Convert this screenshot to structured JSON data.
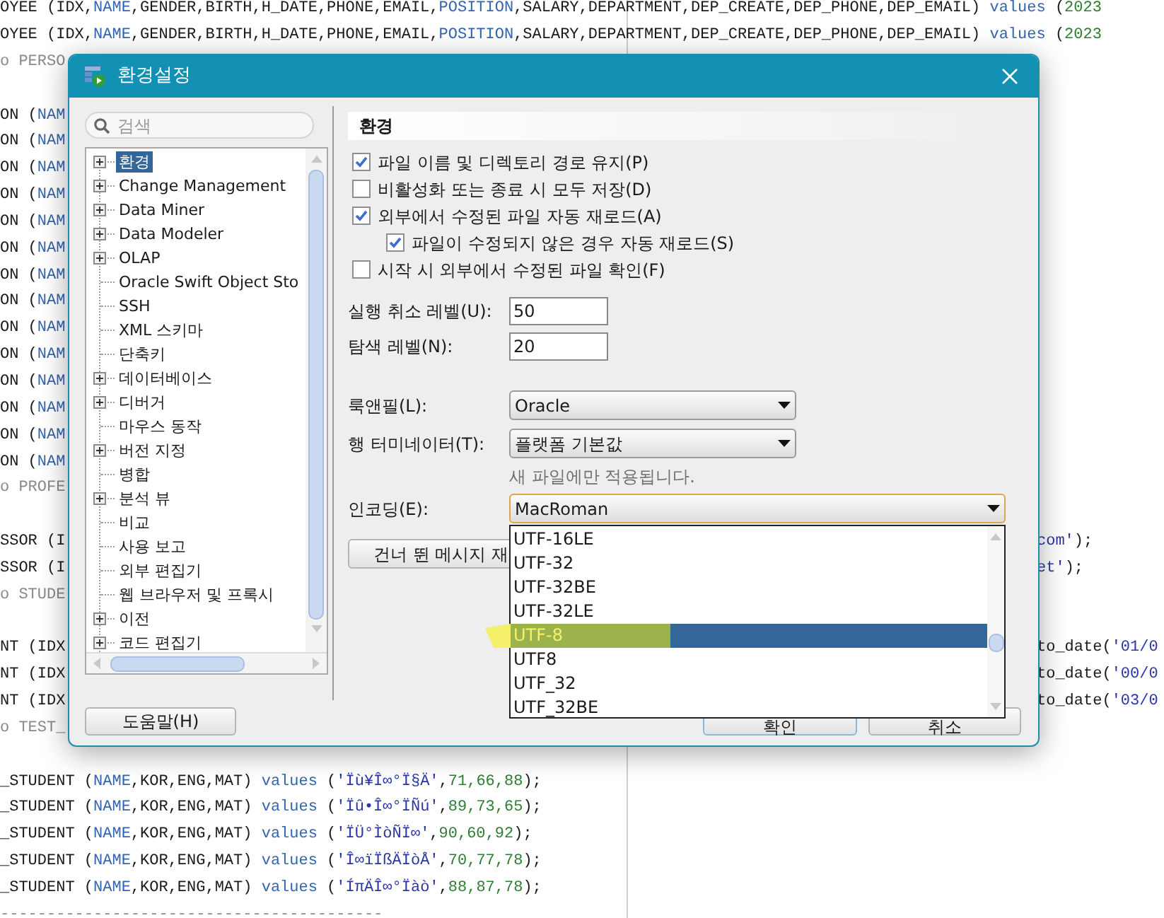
{
  "editor": {
    "lines": [
      {
        "left": [
          {
            "text": "OYEE (IDX,",
            "kind": "t"
          },
          {
            "text": "NAME",
            "kind": "k"
          },
          {
            "text": ",GENDER,BIRTH,H_DATE,PHONE,EMAIL,",
            "kind": "t"
          },
          {
            "text": "POSITION",
            "kind": "k"
          },
          {
            "text": ",SALARY,DEPARTMENT,DEP_CREATE,DEP_PHONE,DEP_EMAIL) ",
            "kind": "t"
          },
          {
            "text": "values",
            "kind": "k"
          },
          {
            "text": " (",
            "kind": "t"
          },
          {
            "text": "2023",
            "kind": "n"
          }
        ]
      },
      {
        "left": [
          {
            "text": "OYEE (IDX,",
            "kind": "t"
          },
          {
            "text": "NAME",
            "kind": "k"
          },
          {
            "text": ",GENDER,BIRTH,H_DATE,PHONE,EMAIL,",
            "kind": "t"
          },
          {
            "text": "POSITION",
            "kind": "k"
          },
          {
            "text": ",SALARY,DEPARTMENT,DEP_CREATE,DEP_PHONE,DEP_EMAIL) ",
            "kind": "t"
          },
          {
            "text": "values",
            "kind": "k"
          },
          {
            "text": " (",
            "kind": "t"
          },
          {
            "text": "2023",
            "kind": "n"
          }
        ]
      },
      {
        "left": [
          {
            "text": "o PERSO",
            "kind": "c"
          }
        ]
      },
      {
        "kind": "blank"
      },
      {
        "left": [
          {
            "text": "ON (",
            "kind": "t"
          },
          {
            "text": "NAM",
            "kind": "k"
          }
        ]
      },
      {
        "left": [
          {
            "text": "ON (",
            "kind": "t"
          },
          {
            "text": "NAM",
            "kind": "k"
          }
        ]
      },
      {
        "left": [
          {
            "text": "ON (",
            "kind": "t"
          },
          {
            "text": "NAM",
            "kind": "k"
          }
        ]
      },
      {
        "left": [
          {
            "text": "ON (",
            "kind": "t"
          },
          {
            "text": "NAM",
            "kind": "k"
          }
        ]
      },
      {
        "left": [
          {
            "text": "ON (",
            "kind": "t"
          },
          {
            "text": "NAM",
            "kind": "k"
          }
        ]
      },
      {
        "left": [
          {
            "text": "ON (",
            "kind": "t"
          },
          {
            "text": "NAM",
            "kind": "k"
          }
        ]
      },
      {
        "left": [
          {
            "text": "ON (",
            "kind": "t"
          },
          {
            "text": "NAM",
            "kind": "k"
          }
        ]
      },
      {
        "left": [
          {
            "text": "ON (",
            "kind": "t"
          },
          {
            "text": "NAM",
            "kind": "k"
          }
        ]
      },
      {
        "left": [
          {
            "text": "ON (",
            "kind": "t"
          },
          {
            "text": "NAM",
            "kind": "k"
          }
        ]
      },
      {
        "left": [
          {
            "text": "ON (",
            "kind": "t"
          },
          {
            "text": "NAM",
            "kind": "k"
          }
        ]
      },
      {
        "left": [
          {
            "text": "ON (",
            "kind": "t"
          },
          {
            "text": "NAM",
            "kind": "k"
          }
        ]
      },
      {
        "left": [
          {
            "text": "ON (",
            "kind": "t"
          },
          {
            "text": "NAM",
            "kind": "k"
          }
        ]
      },
      {
        "left": [
          {
            "text": "ON (",
            "kind": "t"
          },
          {
            "text": "NAM",
            "kind": "k"
          }
        ]
      },
      {
        "left": [
          {
            "text": "ON (",
            "kind": "t"
          },
          {
            "text": "NAM",
            "kind": "k"
          }
        ]
      },
      {
        "left": [
          {
            "text": "o PROFE",
            "kind": "c"
          }
        ]
      },
      {
        "kind": "blank"
      },
      {
        "left": [
          {
            "text": "SSOR (I",
            "kind": "t"
          }
        ],
        "right": [
          {
            "text": "com'",
            "kind": "s"
          },
          {
            "text": ");",
            "kind": "t"
          }
        ]
      },
      {
        "left": [
          {
            "text": "SSOR (I",
            "kind": "t"
          }
        ],
        "right": [
          {
            "text": "et'",
            "kind": "s"
          },
          {
            "text": ");",
            "kind": "t"
          }
        ]
      },
      {
        "left": [
          {
            "text": "o STUDE",
            "kind": "c"
          }
        ]
      },
      {
        "kind": "blank"
      },
      {
        "left": [
          {
            "text": "NT (IDX",
            "kind": "t"
          }
        ],
        "right": [
          {
            "text": "to_date(",
            "kind": "t"
          },
          {
            "text": "'01/0",
            "kind": "s"
          }
        ]
      },
      {
        "left": [
          {
            "text": "NT (IDX",
            "kind": "t"
          }
        ],
        "right": [
          {
            "text": "to_date(",
            "kind": "t"
          },
          {
            "text": "'00/0",
            "kind": "s"
          }
        ]
      },
      {
        "left": [
          {
            "text": "NT (IDX",
            "kind": "t"
          }
        ],
        "right": [
          {
            "text": "to_date(",
            "kind": "t"
          },
          {
            "text": "'03/0",
            "kind": "s"
          }
        ]
      },
      {
        "left": [
          {
            "text": "o TEST_",
            "kind": "c"
          }
        ]
      },
      {
        "kind": "blank"
      },
      {
        "left": [
          {
            "text": "_STUDENT (",
            "kind": "t"
          },
          {
            "text": "NAME",
            "kind": "k"
          },
          {
            "text": ",KOR,ENG,MAT) ",
            "kind": "t"
          },
          {
            "text": "values",
            "kind": "k"
          },
          {
            "text": " (",
            "kind": "t"
          },
          {
            "text": "'Ïù¥Î∞°Ï§Ä'",
            "kind": "s"
          },
          {
            "text": ",",
            "kind": "t"
          },
          {
            "text": "71,66,88",
            "kind": "n"
          },
          {
            "text": ");",
            "kind": "t"
          }
        ]
      },
      {
        "left": [
          {
            "text": "_STUDENT (",
            "kind": "t"
          },
          {
            "text": "NAME",
            "kind": "k"
          },
          {
            "text": ",KOR,ENG,MAT) ",
            "kind": "t"
          },
          {
            "text": "values",
            "kind": "k"
          },
          {
            "text": " (",
            "kind": "t"
          },
          {
            "text": "'Ïû•Î∞°ÏÑú'",
            "kind": "s"
          },
          {
            "text": ",",
            "kind": "t"
          },
          {
            "text": "89,73,65",
            "kind": "n"
          },
          {
            "text": ");",
            "kind": "t"
          }
        ]
      },
      {
        "left": [
          {
            "text": "_STUDENT (",
            "kind": "t"
          },
          {
            "text": "NAME",
            "kind": "k"
          },
          {
            "text": ",KOR,ENG,MAT) ",
            "kind": "t"
          },
          {
            "text": "values",
            "kind": "k"
          },
          {
            "text": " (",
            "kind": "t"
          },
          {
            "text": "'ÏÜ°ÌòÑÏ∞'",
            "kind": "s"
          },
          {
            "text": ",",
            "kind": "t"
          },
          {
            "text": "90,60,92",
            "kind": "n"
          },
          {
            "text": ");",
            "kind": "t"
          }
        ]
      },
      {
        "left": [
          {
            "text": "_STUDENT (",
            "kind": "t"
          },
          {
            "text": "NAME",
            "kind": "k"
          },
          {
            "text": ",KOR,ENG,MAT) ",
            "kind": "t"
          },
          {
            "text": "values",
            "kind": "k"
          },
          {
            "text": " (",
            "kind": "t"
          },
          {
            "text": "'Î∞ïÏßÄÏòÅ'",
            "kind": "s"
          },
          {
            "text": ",",
            "kind": "t"
          },
          {
            "text": "70,77,78",
            "kind": "n"
          },
          {
            "text": ");",
            "kind": "t"
          }
        ]
      },
      {
        "left": [
          {
            "text": "_STUDENT (",
            "kind": "t"
          },
          {
            "text": "NAME",
            "kind": "k"
          },
          {
            "text": ",KOR,ENG,MAT) ",
            "kind": "t"
          },
          {
            "text": "values",
            "kind": "k"
          },
          {
            "text": " (",
            "kind": "t"
          },
          {
            "text": "'ÍπÄÎ∞°Ïàò'",
            "kind": "s"
          },
          {
            "text": ",",
            "kind": "t"
          },
          {
            "text": "88,87,78",
            "kind": "n"
          },
          {
            "text": ");",
            "kind": "t"
          }
        ]
      },
      {
        "left": [
          {
            "text": "-----------------------------------------",
            "kind": "c"
          }
        ]
      }
    ]
  },
  "dialog": {
    "title": "환경설정",
    "search": {
      "placeholder": "검색"
    },
    "tree": [
      {
        "label": "환경",
        "expandable": true,
        "selected": true
      },
      {
        "label": "Change Management",
        "expandable": true,
        "selected": false
      },
      {
        "label": "Data Miner",
        "expandable": true,
        "selected": false
      },
      {
        "label": "Data Modeler",
        "expandable": true,
        "selected": false
      },
      {
        "label": "OLAP",
        "expandable": true,
        "selected": false
      },
      {
        "label": "Oracle Swift Object Sto",
        "expandable": false,
        "selected": false
      },
      {
        "label": "SSH",
        "expandable": false,
        "selected": false
      },
      {
        "label": "XML 스키마",
        "expandable": false,
        "selected": false
      },
      {
        "label": "단축키",
        "expandable": false,
        "selected": false
      },
      {
        "label": "데이터베이스",
        "expandable": true,
        "selected": false
      },
      {
        "label": "디버거",
        "expandable": true,
        "selected": false
      },
      {
        "label": "마우스 동작",
        "expandable": false,
        "selected": false
      },
      {
        "label": "버전 지정",
        "expandable": true,
        "selected": false
      },
      {
        "label": "병합",
        "expandable": false,
        "selected": false
      },
      {
        "label": "분석 뷰",
        "expandable": true,
        "selected": false
      },
      {
        "label": "비교",
        "expandable": false,
        "selected": false
      },
      {
        "label": "사용 보고",
        "expandable": false,
        "selected": false
      },
      {
        "label": "외부 편집기",
        "expandable": false,
        "selected": false
      },
      {
        "label": "웹 브라우저 및 프록시",
        "expandable": false,
        "selected": false
      },
      {
        "label": "이전",
        "expandable": true,
        "selected": false
      },
      {
        "label": "코드 편집기",
        "expandable": true,
        "selected": false
      }
    ],
    "heading": "환경",
    "checkboxes": [
      {
        "label": "파일 이름 및 디렉토리 경로 유지(P)",
        "checked": true
      },
      {
        "label": "비활성화 또는 종료 시 모두 저장(D)",
        "checked": false
      },
      {
        "label": "외부에서 수정된 파일 자동 재로드(A)",
        "checked": true,
        "children": [
          {
            "label": "파일이 수정되지 않은 경우 자동 재로드(S)",
            "checked": true
          }
        ]
      },
      {
        "label": "시작 시 외부에서 수정된 파일 확인(F)",
        "checked": false
      }
    ],
    "fields": [
      {
        "label": "실행 취소 레벨(U):",
        "value": "50"
      },
      {
        "label": "탐색 레벨(N):",
        "value": "20"
      }
    ],
    "selects": [
      {
        "label": "룩앤필(L):",
        "value": "Oracle",
        "focused": false
      },
      {
        "label": "행 터미네이터(T):",
        "value": "플랫폼 기본값",
        "focused": false,
        "note": "새 파일에만 적용됩니다."
      },
      {
        "label": "인코딩(E):",
        "value": "MacRoman",
        "focused": true,
        "options": [
          {
            "text": "UTF-16LE",
            "selected": false,
            "highlighted": false
          },
          {
            "text": "UTF-32",
            "selected": false,
            "highlighted": false
          },
          {
            "text": "UTF-32BE",
            "selected": false,
            "highlighted": false
          },
          {
            "text": "UTF-32LE",
            "selected": false,
            "highlighted": false
          },
          {
            "text": "UTF-8",
            "selected": true,
            "highlighted": true
          },
          {
            "text": "UTF8",
            "selected": false,
            "highlighted": false
          },
          {
            "text": "UTF_32",
            "selected": false,
            "highlighted": false
          },
          {
            "text": "UTF_32BE",
            "selected": false,
            "highlighted": false
          }
        ]
      }
    ],
    "skip_button": "건너 뛴 메시지 재",
    "help_button": "도움말(H)",
    "ok_button": "확인",
    "cancel_button": "취소"
  }
}
